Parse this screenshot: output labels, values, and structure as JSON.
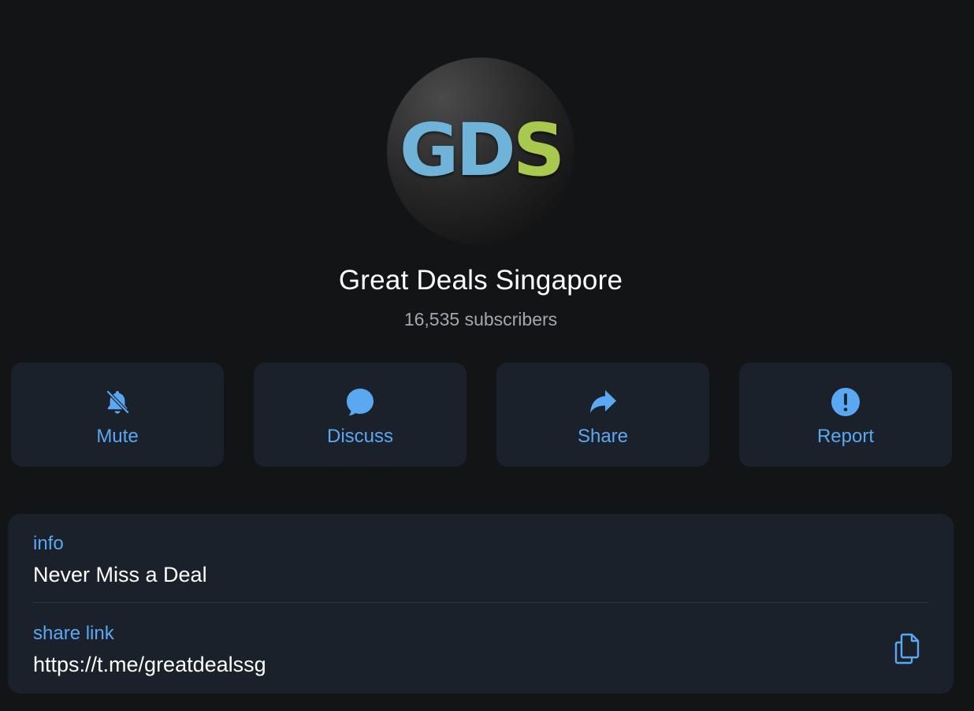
{
  "channel": {
    "avatar_text_gd": "GD",
    "avatar_text_s": "S",
    "name": "Great Deals Singapore",
    "subscribers": "16,535 subscribers"
  },
  "actions": [
    {
      "label": "Mute",
      "icon": "muted-bell-icon"
    },
    {
      "label": "Discuss",
      "icon": "chat-bubble-icon"
    },
    {
      "label": "Share",
      "icon": "share-arrow-icon"
    },
    {
      "label": "Report",
      "icon": "exclamation-icon"
    }
  ],
  "info": {
    "info_label": "info",
    "info_value": "Never Miss a Deal",
    "link_label": "share link",
    "link_value": "https://t.me/greatdealssg",
    "copy_icon": "copy-icon"
  },
  "colors": {
    "background": "#131416",
    "card": "#1a212b",
    "accent": "#5aa8f2",
    "secondary_text": "#a3a8b0",
    "logo_blue": "#6fb3d9",
    "logo_green": "#a9c94e"
  }
}
